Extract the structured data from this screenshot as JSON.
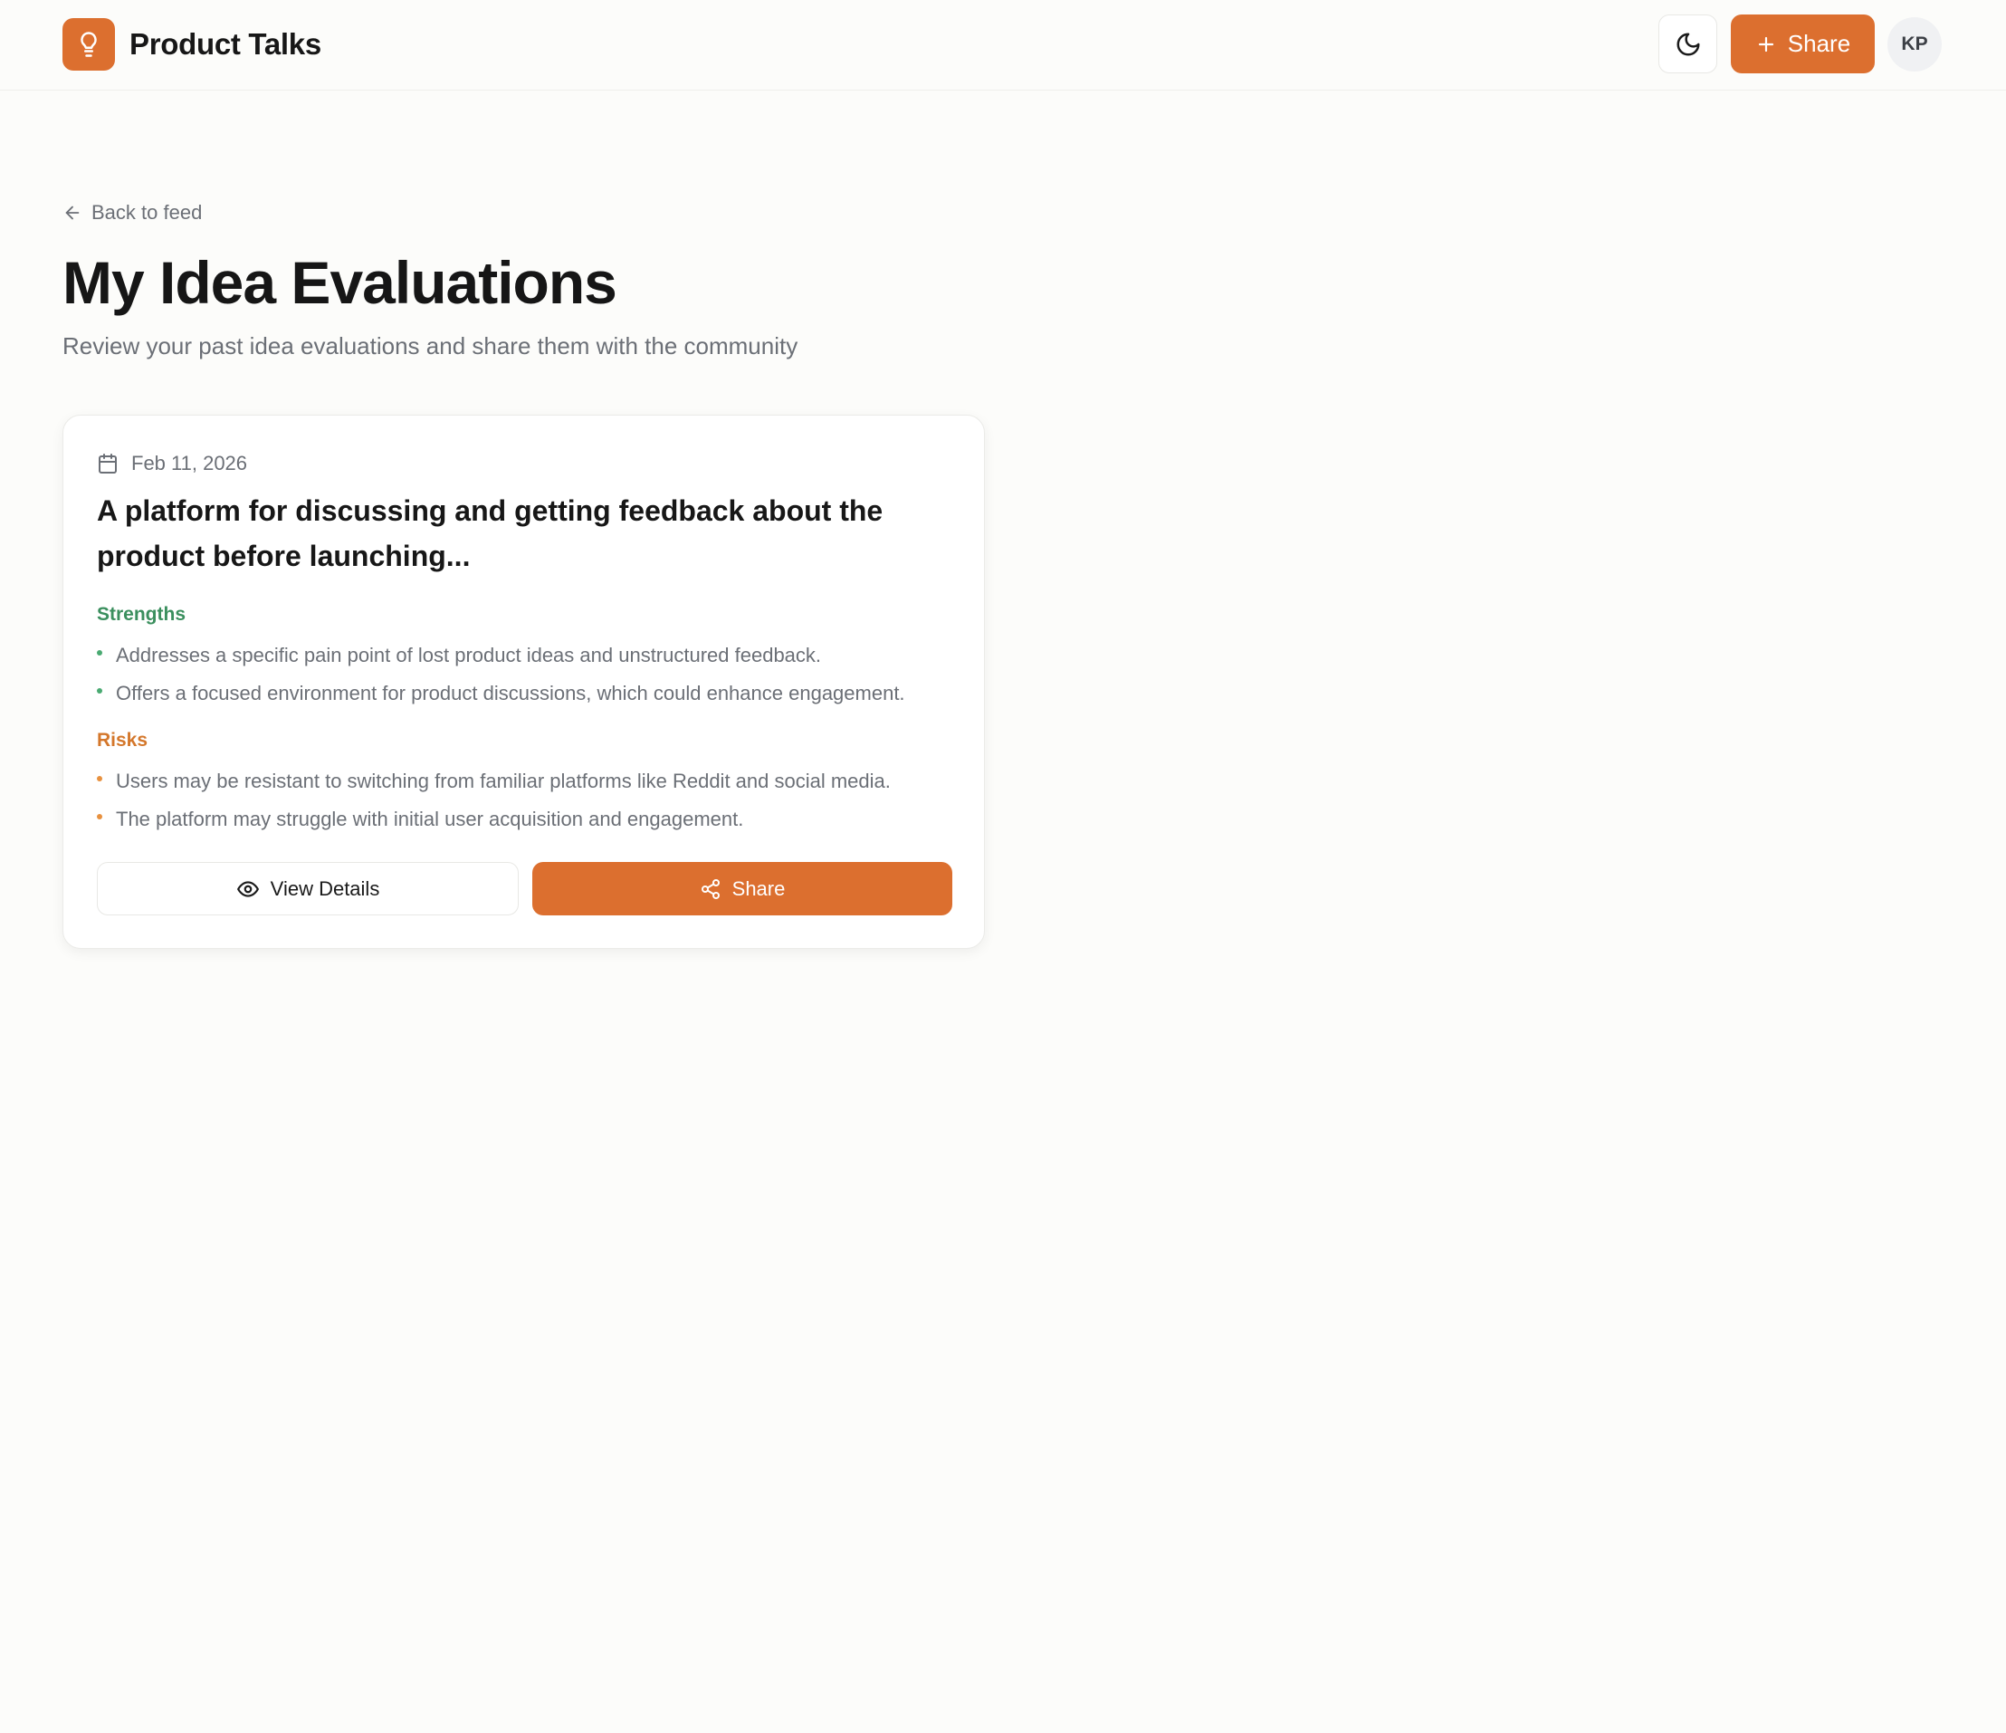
{
  "header": {
    "app_name": "Product Talks",
    "share_label": "Share",
    "avatar_initials": "KP"
  },
  "nav": {
    "back_label": "Back to feed"
  },
  "page": {
    "title": "My Idea Evaluations",
    "subtitle": "Review your past idea evaluations and share them with the community"
  },
  "evaluation": {
    "date": "Feb 11, 2026",
    "title_line1": "A platform for discussing and getting feedback about the",
    "title_line2": "product before launching...",
    "strengths_label": "Strengths",
    "strengths": [
      "Addresses a specific pain point of lost product ideas and unstructured feedback.",
      "Offers a focused environment for product discussions, which could enhance engagement."
    ],
    "risks_label": "Risks",
    "risks": [
      "Users may be resistant to switching from familiar platforms like Reddit and social media.",
      "The platform may struggle with initial user acquisition and engagement."
    ],
    "view_details_label": "View Details",
    "share_label": "Share"
  },
  "colors": {
    "accent": "#dc6f2f",
    "strengths": "#3b8f5e",
    "risks": "#d4772b"
  }
}
